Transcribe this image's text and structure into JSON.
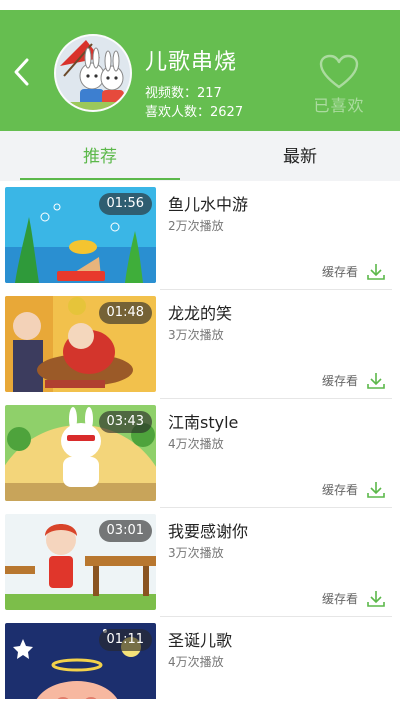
{
  "header": {
    "title": "儿歌串烧",
    "video_count": "视频数：217",
    "like_count": "喜欢人数：2627",
    "like_label": "已喜欢",
    "back_icon": "chevron-left-icon",
    "like_icon": "heart-outline-icon",
    "color": "#66be50"
  },
  "tabs": [
    {
      "label": "推荐",
      "active": true
    },
    {
      "label": "最新",
      "active": false
    }
  ],
  "accent_color": "#5cb84a",
  "videos": [
    {
      "title": "鱼儿水中游",
      "plays": "2万次播放",
      "duration": "01:56",
      "cache_label": "缓存看"
    },
    {
      "title": "龙龙的笑",
      "plays": "3万次播放",
      "duration": "01:48",
      "cache_label": "缓存看"
    },
    {
      "title": "江南style",
      "plays": "4万次播放",
      "duration": "03:43",
      "cache_label": "缓存看"
    },
    {
      "title": "我要感谢你",
      "plays": "3万次播放",
      "duration": "03:01",
      "cache_label": "缓存看"
    },
    {
      "title": "圣诞儿歌",
      "plays": "4万次播放",
      "duration": "01:11",
      "cache_label": "缓存看"
    }
  ]
}
